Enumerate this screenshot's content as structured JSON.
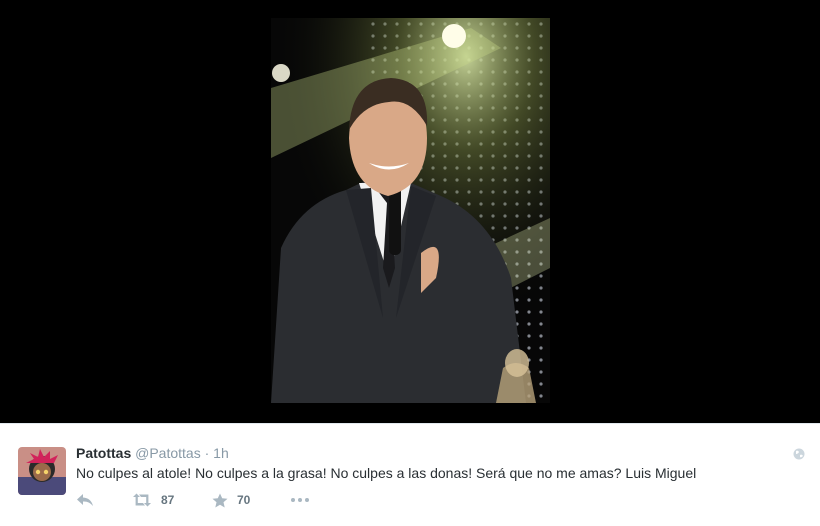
{
  "tweet": {
    "fullname": "Patottas",
    "username": "@Patottas",
    "separator": "·",
    "time": "1h",
    "text": "No culpes al atole! No culpes a la grasa! No culpes a las donas! Será que no me amas? Luis Miguel",
    "retweet_count": "87",
    "favorite_count": "70"
  },
  "icons": {
    "reply": "reply-icon",
    "retweet": "retweet-icon",
    "favorite": "star-icon",
    "more": "ellipsis-icon",
    "globe": "globe-icon"
  },
  "colors": {
    "media_background": "#000000",
    "action_icon": "#aab8c2",
    "meta_text": "#8899a6"
  }
}
